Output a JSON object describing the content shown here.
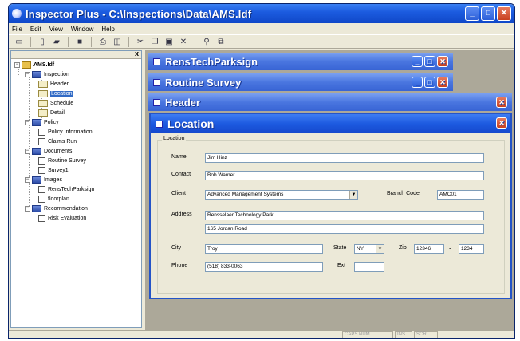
{
  "window": {
    "title": "Inspector Plus - C:\\Inspections\\Data\\AMS.Idf"
  },
  "menu": [
    "File",
    "Edit",
    "View",
    "Window",
    "Help"
  ],
  "tree": {
    "root": "AMS.Idf",
    "inspection": "Inspection",
    "inspection_items": [
      "Header",
      "Location",
      "Schedule",
      "Detail"
    ],
    "policy": "Policy",
    "policy_items": [
      "Policy Information",
      "Claims Run"
    ],
    "documents": "Documents",
    "documents_items": [
      "Routine Survey",
      "Survey1"
    ],
    "images": "Images",
    "images_items": [
      "RensTechParksign",
      "floorplan"
    ],
    "recommendation": "Recommendation",
    "recommendation_items": [
      "Risk Evaluation"
    ],
    "close_glyph": "x"
  },
  "child_windows": {
    "rens": "RensTechParksign",
    "routine": "Routine Survey",
    "header": "Header",
    "location": "Location"
  },
  "form": {
    "group_label": "Location",
    "name_label": "Name",
    "name_value": "Jim Hinz",
    "contact_label": "Contact",
    "contact_value": "Bob Warner",
    "client_label": "Client",
    "client_value": "Advanced Management Systems",
    "branch_label": "Branch Code",
    "branch_value": "AMC01",
    "address_label": "Address",
    "address1": "Rensselaer Technology Park",
    "address2": "165 Jordan Road",
    "city_label": "City",
    "city_value": "Troy",
    "state_label": "State",
    "state_value": "NY",
    "zip_label": "Zip",
    "zip_value": "12346",
    "zip_dash": "-",
    "zip_ext": "1234",
    "phone_label": "Phone",
    "phone_value": "(518) 833-0063",
    "ext_label": "Ext",
    "ext_value": ""
  },
  "status": {
    "cap": "CAPS NUM",
    "ins": "INS",
    "scrl": "SCRL"
  }
}
